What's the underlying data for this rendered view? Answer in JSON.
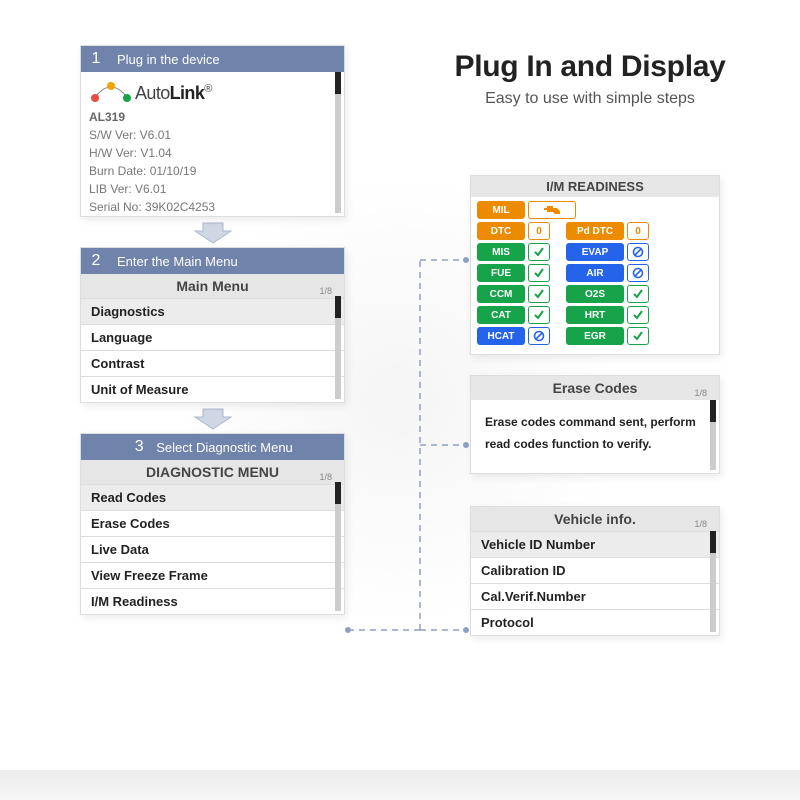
{
  "header": {
    "title": "Plug In and Display",
    "subtitle": "Easy to use with simple steps"
  },
  "step1": {
    "num": "1",
    "label": "Plug in the device",
    "brand_prefix": "Auto",
    "brand_suffix": "Link",
    "brand_reg": "®",
    "model": "AL319",
    "lines": {
      "sw": "S/W Ver: V6.01",
      "hw": "H/W Ver: V1.04",
      "burn": "Burn Date: 01/10/19",
      "lib": "LIB Ver: V6.01",
      "serial": "Serial No: 39K02C4253"
    }
  },
  "step2": {
    "num": "2",
    "label": "Enter the Main Menu",
    "title": "Main Menu",
    "page": "1/8",
    "items": {
      "a": "Diagnostics",
      "b": "Language",
      "c": "Contrast",
      "d": "Unit of Measure"
    }
  },
  "step3": {
    "num": "3",
    "label": "Select Diagnostic Menu",
    "title": "DIAGNOSTIC MENU",
    "page": "1/8",
    "items": {
      "a": "Read Codes",
      "b": "Erase Codes",
      "c": "Live  Data",
      "d": "View Freeze Frame",
      "e": "I/M Readiness"
    }
  },
  "im": {
    "title": "I/M READINESS",
    "top": {
      "mil": "MIL",
      "dtc": "DTC",
      "dtc_n": "0",
      "pd": "Pd DTC",
      "pd_n": "0"
    },
    "left": {
      "a": "MIS",
      "b": "FUE",
      "c": "CCM",
      "d": "CAT",
      "e": "HCAT"
    },
    "right": {
      "a": "EVAP",
      "b": "AIR",
      "c": "O2S",
      "d": "HRT",
      "e": "EGR"
    }
  },
  "erase": {
    "title": "Erase Codes",
    "page": "1/8",
    "body": "Erase codes command sent, perform read codes function to verify."
  },
  "vinfo": {
    "title": "Vehicle info.",
    "page": "1/8",
    "items": {
      "a": "Vehicle ID Number",
      "b": "Calibration ID",
      "c": "Cal.Verif.Number",
      "d": "Protocol"
    }
  }
}
